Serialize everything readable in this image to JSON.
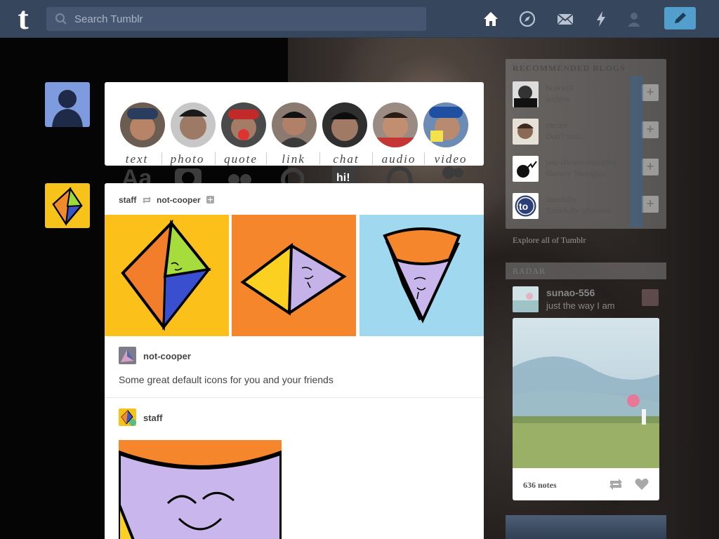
{
  "header": {
    "logo": "t",
    "search_placeholder": "Search Tumblr",
    "nav_icons": [
      "home-icon",
      "explore-icon",
      "inbox-icon",
      "activity-icon",
      "account-icon"
    ],
    "compose_icon": "pencil-icon"
  },
  "post_box": {
    "types": [
      {
        "label": "text",
        "icon": "Aa"
      },
      {
        "label": "photo",
        "icon": "camera"
      },
      {
        "label": "quote",
        "icon": "quote-marks"
      },
      {
        "label": "link",
        "icon": "chain"
      },
      {
        "label": "chat",
        "icon": "hi!"
      },
      {
        "label": "audio",
        "icon": "headphones"
      },
      {
        "label": "video",
        "icon": "video-camera"
      }
    ]
  },
  "post": {
    "reblogger": "staff",
    "origin": "not-cooper",
    "trail": [
      {
        "name": "not-cooper",
        "text": "Some great default icons for you and your friends"
      },
      {
        "name": "staff"
      }
    ]
  },
  "sidebar": {
    "recommended": {
      "title": "RECOMMENDED BLOGS",
      "items": [
        {
          "name": "brakwill",
          "sub": "archive"
        },
        {
          "name": "encore",
          "sub": "Don't trust..."
        },
        {
          "name": "just-shower-thoughts",
          "sub": "Shower Thoughts"
        },
        {
          "name": "tastefully",
          "sub": "Tastefully offensive"
        }
      ],
      "explore": "Explore all of Tumblr"
    },
    "radar": {
      "title": "RADAR",
      "user": "sunao-556",
      "subtitle": "just the way I am",
      "notes": "636 notes"
    }
  },
  "colors": {
    "header_bg": "#36465d",
    "compose": "#529ecc",
    "page_bg": "#050505"
  }
}
